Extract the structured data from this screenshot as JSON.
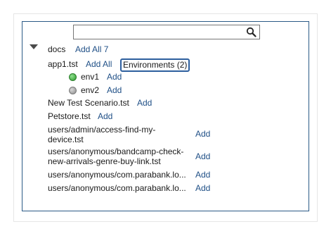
{
  "search": {
    "value": "",
    "placeholder": "",
    "icon": "search-icon"
  },
  "tree": {
    "root": {
      "label": "docs",
      "add_all_label": "Add All 7",
      "expanded": true
    },
    "app1": {
      "label": "app1.tst",
      "add_all_label": "Add All",
      "environments_label": "Environments (2)",
      "environments": [
        {
          "label": "env1",
          "status": "active",
          "color": "#3aa53a",
          "add_label": "Add"
        },
        {
          "label": "env2",
          "status": "inactive",
          "color": "#9a9a9a",
          "add_label": "Add"
        }
      ]
    },
    "files": [
      {
        "label": "New Test Scenario.tst",
        "add_label": "Add"
      },
      {
        "label": "Petstore.tst",
        "add_label": "Add"
      },
      {
        "label_line1": "users/admin/access-find-my-",
        "label_line2": "device.tst",
        "add_label": "Add"
      },
      {
        "label_line1": "users/anonymous/bandcamp-check-",
        "label_line2": "new-arrivals-genre-buy-link.tst",
        "add_label": "Add"
      },
      {
        "label": "users/anonymous/com.parabank.lo...",
        "add_label": "Add"
      },
      {
        "label": "users/anonymous/com.parabank.lo...",
        "add_label": "Add"
      }
    ]
  },
  "colors": {
    "panel_border": "#2b5a86",
    "link": "#1f4f86",
    "focus_border": "#2d5f9e"
  }
}
